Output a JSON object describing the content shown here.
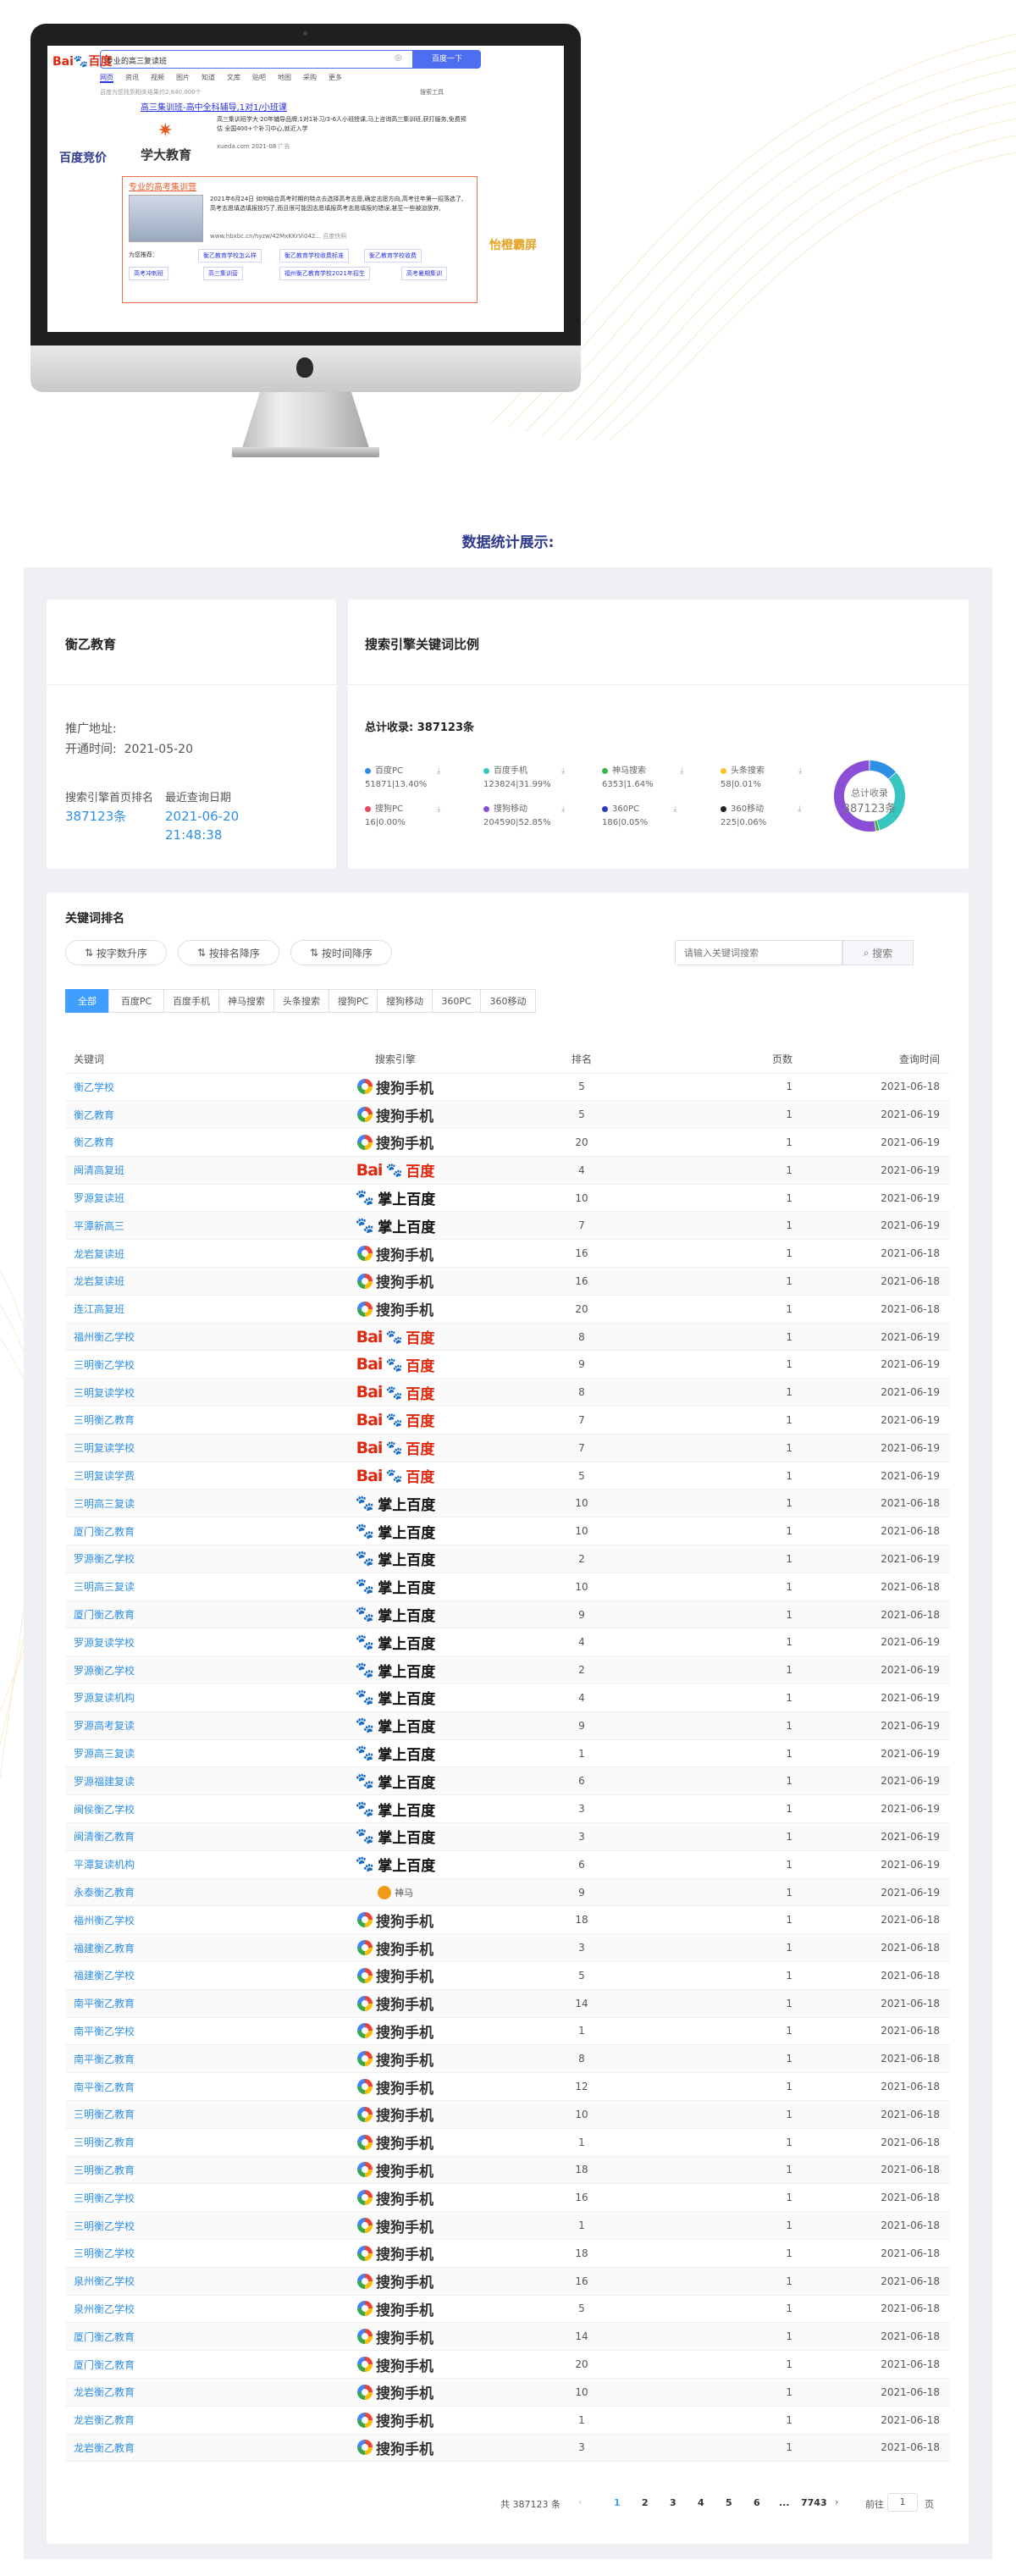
{
  "screen": {
    "search_query": "专业的高三复读班",
    "search_button": "百度一下",
    "nav_tabs": [
      "网页",
      "资讯",
      "视频",
      "图片",
      "知道",
      "文库",
      "贴吧",
      "地图",
      "采购",
      "更多"
    ],
    "result_count": "百度为您找到相关结果约2,840,000个",
    "search_tools": "搜索工具",
    "ad1": {
      "title": "高三集训班-高中全科辅导,1对1/小班课",
      "desc": "高三集训班学大·20年辅导品牌,1对1补习/3-6人小班授课,马上咨询高三集训班,获打服务,免费预估 全国400+个补习中心,就近入学",
      "url": "xueda.com 2021-08",
      "tag": "广告"
    },
    "ad2": {
      "title": "专业的高考集训营",
      "desc": "2021年6月24日 如何结合高考时期的特点去选择高考志愿,确定志愿方向,高考往年第一招落选了,高考志愿填选填报技巧了,而且很可能因志愿填报高考志愿填报的错误,甚至一些被迫放弃,",
      "url": "www.hbxbc.cn/hyzw/42MxKKrVi042...",
      "tag": "百度快照"
    },
    "sitelinks_label": "为您推荐：",
    "sitelinks": [
      "衡乙教育学校怎么样",
      "衡乙教育学校收费标准",
      "衡乙教育学校收费",
      "高考冲刺班",
      "高三集训营",
      "福州衡乙教育学校2021年招生",
      "高考暑期集训"
    ],
    "label_left": "百度竞价",
    "label_right": "怡橙霸屏",
    "brand": "学大教育"
  },
  "section_title": "数据统计展示:",
  "company": {
    "name": "衡乙教育",
    "address_label": "推广地址:",
    "open_label": "开通时间:",
    "open_date": "2021-05-20",
    "top_label": "搜索引擎首页排名",
    "top_value": "387123条",
    "last_label": "最近查询日期",
    "last_value": "2021-06-20 21:48:38"
  },
  "ratio": {
    "title": "搜索引擎关键词比例",
    "total_label": "总计收录:",
    "total_value": "387123条",
    "donut_label": "总计收录",
    "donut_value": "387123条",
    "legend": [
      {
        "name": "百度PC",
        "value": "51871|13.40%",
        "color": "#2f8fe6",
        "share": 13.4
      },
      {
        "name": "百度手机",
        "value": "123824|31.99%",
        "color": "#36c5c0",
        "share": 31.99
      },
      {
        "name": "神马搜索",
        "value": "6353|1.64%",
        "color": "#3bb54a",
        "share": 1.64
      },
      {
        "name": "头条搜索",
        "value": "58|0.01%",
        "color": "#f7c02c",
        "share": 0.01
      },
      {
        "name": "搜狗PC",
        "value": "16|0.00%",
        "color": "#e8445a",
        "share": 0.0
      },
      {
        "name": "搜狗移动",
        "value": "204590|52.85%",
        "color": "#8a4fd6",
        "share": 52.85
      },
      {
        "name": "360PC",
        "value": "186|0.05%",
        "color": "#2d3bb8",
        "share": 0.05
      },
      {
        "name": "360移动",
        "value": "225|0.06%",
        "color": "#222222",
        "share": 0.06
      }
    ]
  },
  "ranking": {
    "title": "关键词排名",
    "sort_buttons": [
      "按字数升序",
      "按排名降序",
      "按时间降序"
    ],
    "search_placeholder": "请输入关键词搜索",
    "search_button": "搜索",
    "tabs": [
      "全部",
      "百度PC",
      "百度手机",
      "神马搜索",
      "头条搜索",
      "搜狗PC",
      "搜狗移动",
      "360PC",
      "360移动"
    ],
    "columns": [
      "关键词",
      "搜索引擎",
      "排名",
      "页数",
      "查询时间"
    ],
    "engine_labels": {
      "sogou": "搜狗手机",
      "baidu_t1": "Bai",
      "baidu_t2": "百度",
      "zhangshang": "掌上百度",
      "shenma": "神马"
    },
    "rows": [
      [
        "衡乙学校",
        "sogou",
        "5",
        "1",
        "2021-06-18"
      ],
      [
        "衡乙教育",
        "sogou",
        "5",
        "1",
        "2021-06-19"
      ],
      [
        "衡乙教育",
        "sogou",
        "20",
        "1",
        "2021-06-19"
      ],
      [
        "闽清高复班",
        "baidu",
        "4",
        "1",
        "2021-06-19"
      ],
      [
        "罗源复读班",
        "zhangshang",
        "10",
        "1",
        "2021-06-19"
      ],
      [
        "平潭新高三",
        "zhangshang",
        "7",
        "1",
        "2021-06-19"
      ],
      [
        "龙岩复读班",
        "sogou",
        "16",
        "1",
        "2021-06-18"
      ],
      [
        "龙岩复读班",
        "sogou",
        "16",
        "1",
        "2021-06-18"
      ],
      [
        "连江高复班",
        "sogou",
        "20",
        "1",
        "2021-06-18"
      ],
      [
        "福州衡乙学校",
        "baidu",
        "8",
        "1",
        "2021-06-19"
      ],
      [
        "三明衡乙学校",
        "baidu",
        "9",
        "1",
        "2021-06-19"
      ],
      [
        "三明复读学校",
        "baidu",
        "8",
        "1",
        "2021-06-19"
      ],
      [
        "三明衡乙教育",
        "baidu",
        "7",
        "1",
        "2021-06-19"
      ],
      [
        "三明复读学校",
        "baidu",
        "7",
        "1",
        "2021-06-19"
      ],
      [
        "三明复读学费",
        "baidu",
        "5",
        "1",
        "2021-06-19"
      ],
      [
        "三明高三复读",
        "zhangshang",
        "10",
        "1",
        "2021-06-18"
      ],
      [
        "厦门衡乙教育",
        "zhangshang",
        "10",
        "1",
        "2021-06-18"
      ],
      [
        "罗源衡乙学校",
        "zhangshang",
        "2",
        "1",
        "2021-06-19"
      ],
      [
        "三明高三复读",
        "zhangshang",
        "10",
        "1",
        "2021-06-18"
      ],
      [
        "厦门衡乙教育",
        "zhangshang",
        "9",
        "1",
        "2021-06-18"
      ],
      [
        "罗源复读学校",
        "zhangshang",
        "4",
        "1",
        "2021-06-19"
      ],
      [
        "罗源衡乙学校",
        "zhangshang",
        "2",
        "1",
        "2021-06-19"
      ],
      [
        "罗源复读机构",
        "zhangshang",
        "4",
        "1",
        "2021-06-19"
      ],
      [
        "罗源高考复读",
        "zhangshang",
        "9",
        "1",
        "2021-06-19"
      ],
      [
        "罗源高三复读",
        "zhangshang",
        "1",
        "1",
        "2021-06-19"
      ],
      [
        "罗源福建复读",
        "zhangshang",
        "6",
        "1",
        "2021-06-19"
      ],
      [
        "闽侯衡乙学校",
        "zhangshang",
        "3",
        "1",
        "2021-06-19"
      ],
      [
        "闽清衡乙教育",
        "zhangshang",
        "3",
        "1",
        "2021-06-19"
      ],
      [
        "平潭复读机构",
        "zhangshang",
        "6",
        "1",
        "2021-06-19"
      ],
      [
        "永泰衡乙教育",
        "shenma",
        "9",
        "1",
        "2021-06-19"
      ],
      [
        "福州衡乙学校",
        "sogou",
        "18",
        "1",
        "2021-06-18"
      ],
      [
        "福建衡乙教育",
        "sogou",
        "3",
        "1",
        "2021-06-18"
      ],
      [
        "福建衡乙学校",
        "sogou",
        "5",
        "1",
        "2021-06-18"
      ],
      [
        "南平衡乙教育",
        "sogou",
        "14",
        "1",
        "2021-06-18"
      ],
      [
        "南平衡乙学校",
        "sogou",
        "1",
        "1",
        "2021-06-18"
      ],
      [
        "南平衡乙教育",
        "sogou",
        "8",
        "1",
        "2021-06-18"
      ],
      [
        "南平衡乙教育",
        "sogou",
        "12",
        "1",
        "2021-06-18"
      ],
      [
        "三明衡乙教育",
        "sogou",
        "10",
        "1",
        "2021-06-18"
      ],
      [
        "三明衡乙教育",
        "sogou",
        "1",
        "1",
        "2021-06-18"
      ],
      [
        "三明衡乙教育",
        "sogou",
        "18",
        "1",
        "2021-06-18"
      ],
      [
        "三明衡乙学校",
        "sogou",
        "16",
        "1",
        "2021-06-18"
      ],
      [
        "三明衡乙学校",
        "sogou",
        "1",
        "1",
        "2021-06-18"
      ],
      [
        "三明衡乙学校",
        "sogou",
        "18",
        "1",
        "2021-06-18"
      ],
      [
        "泉州衡乙学校",
        "sogou",
        "16",
        "1",
        "2021-06-18"
      ],
      [
        "泉州衡乙学校",
        "sogou",
        "5",
        "1",
        "2021-06-18"
      ],
      [
        "厦门衡乙教育",
        "sogou",
        "14",
        "1",
        "2021-06-18"
      ],
      [
        "厦门衡乙教育",
        "sogou",
        "20",
        "1",
        "2021-06-18"
      ],
      [
        "龙岩衡乙教育",
        "sogou",
        "10",
        "1",
        "2021-06-18"
      ],
      [
        "龙岩衡乙教育",
        "sogou",
        "1",
        "1",
        "2021-06-18"
      ],
      [
        "龙岩衡乙教育",
        "sogou",
        "3",
        "1",
        "2021-06-18"
      ]
    ]
  },
  "pagination": {
    "total": "共 387123 条",
    "pages": [
      "1",
      "2",
      "3",
      "4",
      "5",
      "6",
      "...",
      "7743"
    ],
    "current": "1",
    "goto_label": "前往",
    "goto_value": "1",
    "page_suffix": "页"
  }
}
